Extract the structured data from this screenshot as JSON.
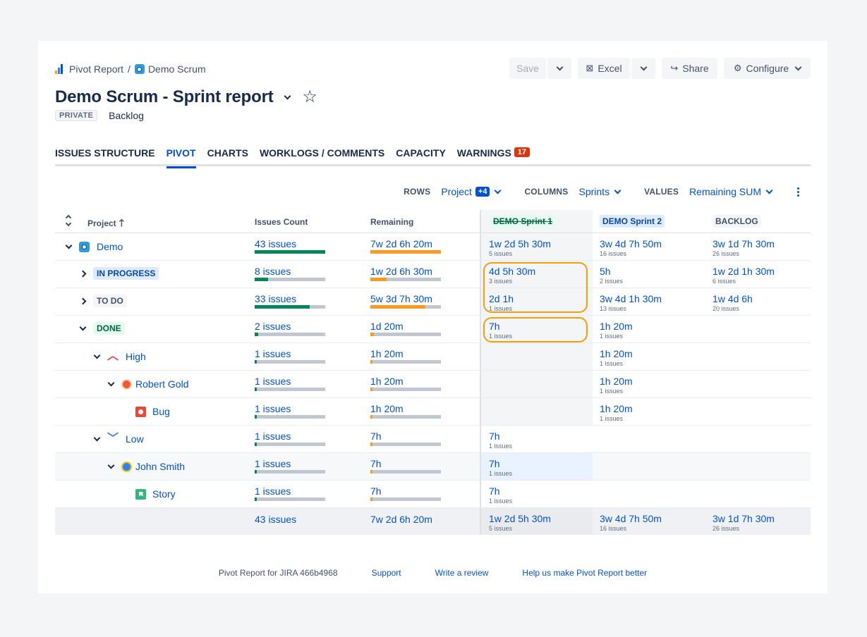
{
  "breadcrumb": {
    "root": "Pivot Report",
    "separator": "/",
    "project": "Demo Scrum"
  },
  "toolbar": {
    "save": "Save",
    "excel": "Excel",
    "share": "Share",
    "configure": "Configure"
  },
  "title": "Demo Scrum - Sprint report",
  "meta": {
    "visibility": "PRIVATE",
    "view": "Backlog"
  },
  "tabs": [
    {
      "label": "ISSUES STRUCTURE"
    },
    {
      "label": "PIVOT",
      "active": true
    },
    {
      "label": "CHARTS"
    },
    {
      "label": "WORKLOGS / COMMENTS"
    },
    {
      "label": "CAPACITY"
    },
    {
      "label": "WARNINGS",
      "badge": "17"
    }
  ],
  "controls": {
    "rows_label": "ROWS",
    "rows_value": "Project",
    "rows_extra": "+4",
    "columns_label": "COLUMNS",
    "columns_value": "Sprints",
    "values_label": "VALUES",
    "values_value": "Remaining SUM"
  },
  "headers": {
    "project": "Project",
    "sort_arrow": "🡑",
    "count": "Issues Count",
    "remaining": "Remaining",
    "sprint1": "DEMO Sprint 1",
    "sprint2": "DEMO Sprint 2",
    "backlog": "BACKLOG"
  },
  "rows": [
    {
      "label": "Demo",
      "count": "43 issues",
      "count_ratio": 1.0,
      "remaining": "7w 2d 6h 20m",
      "rem_ratio": 1.0,
      "s1": "1w 2d 5h 30m",
      "s1_sub": "5 issues",
      "s2": "3w 4d 7h 50m",
      "s2_sub": "16 issues",
      "bl": "3w 1d 7h 30m",
      "bl_sub": "26 issues"
    },
    {
      "label": "IN PROGRESS",
      "count": "8 issues",
      "count_ratio": 0.19,
      "remaining": "1w 2d 6h 30m",
      "rem_ratio": 0.23,
      "s1": "4d 5h 30m",
      "s1_sub": "3 issues",
      "s2": "5h",
      "s2_sub": "2 issues",
      "bl": "1w 2d 1h 30m",
      "bl_sub": "6 issues"
    },
    {
      "label": "TO DO",
      "count": "33 issues",
      "count_ratio": 0.78,
      "remaining": "5w 3d 7h 30m",
      "rem_ratio": 0.78,
      "s1": "2d 1h",
      "s1_sub": "1 issues",
      "s2": "3w 4d 1h 30m",
      "s2_sub": "13 issues",
      "bl": "1w 4d 6h",
      "bl_sub": "20 issues"
    },
    {
      "label": "DONE",
      "count": "2 issues",
      "count_ratio": 0.05,
      "remaining": "1d 20m",
      "rem_ratio": 0.05,
      "s1": "7h",
      "s1_sub": "1 issues",
      "s2": "1h 20m",
      "s2_sub": "1 issues",
      "bl": "",
      "bl_sub": ""
    },
    {
      "label": "High",
      "count": "1 issues",
      "count_ratio": 0.025,
      "remaining": "1h 20m",
      "rem_ratio": 0.02,
      "s1": "",
      "s1_sub": "",
      "s2": "1h 20m",
      "s2_sub": "1 issues",
      "bl": "",
      "bl_sub": ""
    },
    {
      "label": "Robert Gold",
      "count": "1 issues",
      "count_ratio": 0.025,
      "remaining": "1h 20m",
      "rem_ratio": 0.02,
      "s1": "",
      "s1_sub": "",
      "s2": "1h 20m",
      "s2_sub": "1 issues",
      "bl": "",
      "bl_sub": ""
    },
    {
      "label": "Bug",
      "count": "1 issues",
      "count_ratio": 0.025,
      "remaining": "1h 20m",
      "rem_ratio": 0.02,
      "s1": "",
      "s1_sub": "",
      "s2": "1h 20m",
      "s2_sub": "1 issues",
      "bl": "",
      "bl_sub": ""
    },
    {
      "label": "Low",
      "count": "1 issues",
      "count_ratio": 0.025,
      "remaining": "7h",
      "rem_ratio": 0.02,
      "s1": "7h",
      "s1_sub": "1 issues",
      "s2": "",
      "s2_sub": "",
      "bl": "",
      "bl_sub": ""
    },
    {
      "label": "John Smith",
      "count": "1 issues",
      "count_ratio": 0.025,
      "remaining": "7h",
      "rem_ratio": 0.02,
      "s1": "7h",
      "s1_sub": "1 issues",
      "s2": "",
      "s2_sub": "",
      "bl": "",
      "bl_sub": ""
    },
    {
      "label": "Story",
      "count": "1 issues",
      "count_ratio": 0.025,
      "remaining": "7h",
      "rem_ratio": 0.02,
      "s1": "7h",
      "s1_sub": "1 issues",
      "s2": "",
      "s2_sub": "",
      "bl": "",
      "bl_sub": ""
    }
  ],
  "total": {
    "count": "43 issues",
    "remaining": "7w 2d 6h 20m",
    "s1": "1w 2d 5h 30m",
    "s1_sub": "5 issues",
    "s2": "3w 4d 7h 50m",
    "s2_sub": "16 issues",
    "bl": "3w 1d 7h 30m",
    "bl_sub": "26 issues"
  },
  "footer": {
    "version": "Pivot Report for JIRA 466b4968",
    "support": "Support",
    "review": "Write a review",
    "better": "Help us make Pivot Report better"
  },
  "colors": {
    "accent": "#0052cc",
    "green": "#00875a",
    "orange": "#ff991f",
    "highlight": "#f59e0b"
  }
}
